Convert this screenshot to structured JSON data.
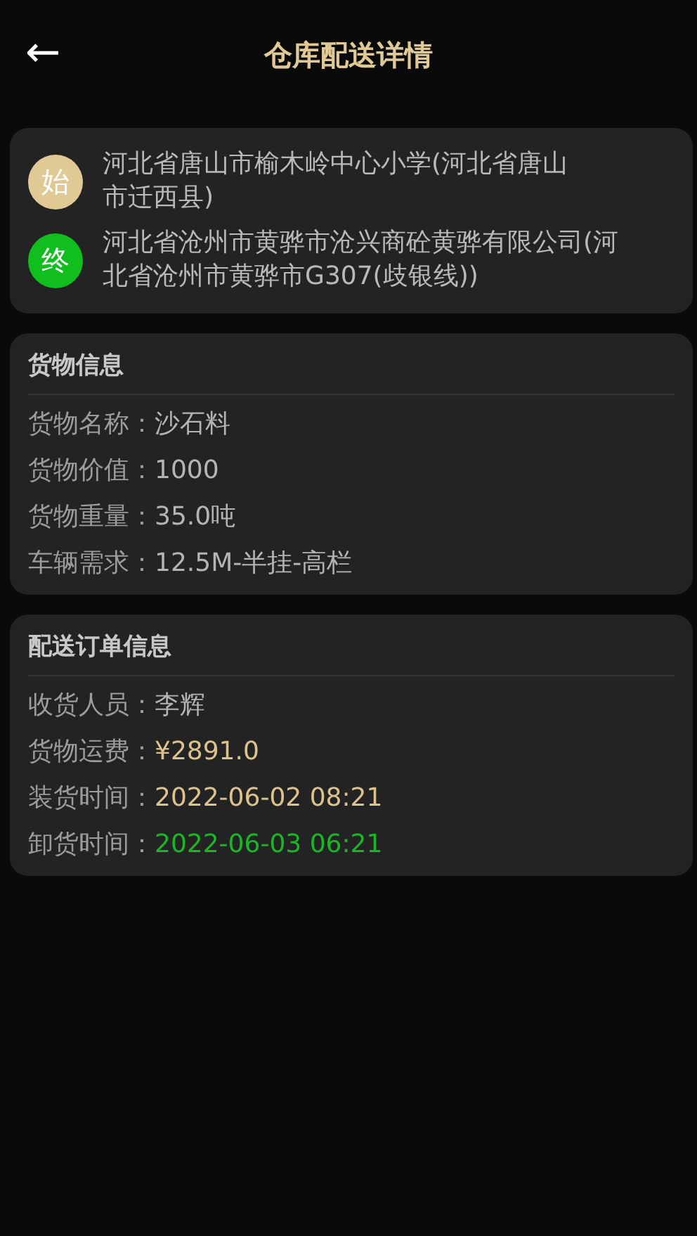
{
  "header": {
    "back": "←",
    "title": "仓库配送详情"
  },
  "route": [
    {
      "badge": "始",
      "color": "#e0c994",
      "address": "河北省唐山市榆木岭中心小学(河北省唐山市迁西县)"
    },
    {
      "badge": "终",
      "color": "#10bf1e",
      "address": "河北省沧州市黄骅市沧兴商砼黄骅有限公司(河北省沧州市黄骅市G307(歧银线))"
    }
  ],
  "sections": [
    {
      "title": "货物信息",
      "fields": [
        {
          "label": "货物名称：",
          "value": "沙石料",
          "color": "#b4b4b4"
        },
        {
          "label": "货物价值：",
          "value": "1000",
          "color": "#b4b4b4"
        },
        {
          "label": "货物重量：",
          "value": "35.0吨",
          "color": "#b4b4b4"
        },
        {
          "label": "车辆需求：",
          "value": "12.5M-半挂-高栏",
          "color": "#b4b4b4"
        }
      ]
    },
    {
      "title": "配送订单信息",
      "fields": [
        {
          "label": "收货人员：",
          "value": "李辉",
          "color": "#b4b4b4"
        },
        {
          "label": "货物运费：",
          "value": "¥2891.0",
          "color": "#dcc38e"
        },
        {
          "label": "装货时间：",
          "value": "2022-06-02 08:21",
          "color": "#dcc38e"
        },
        {
          "label": "卸货时间：",
          "value": "2022-06-03 06:21",
          "color": "#18b824"
        }
      ]
    }
  ]
}
